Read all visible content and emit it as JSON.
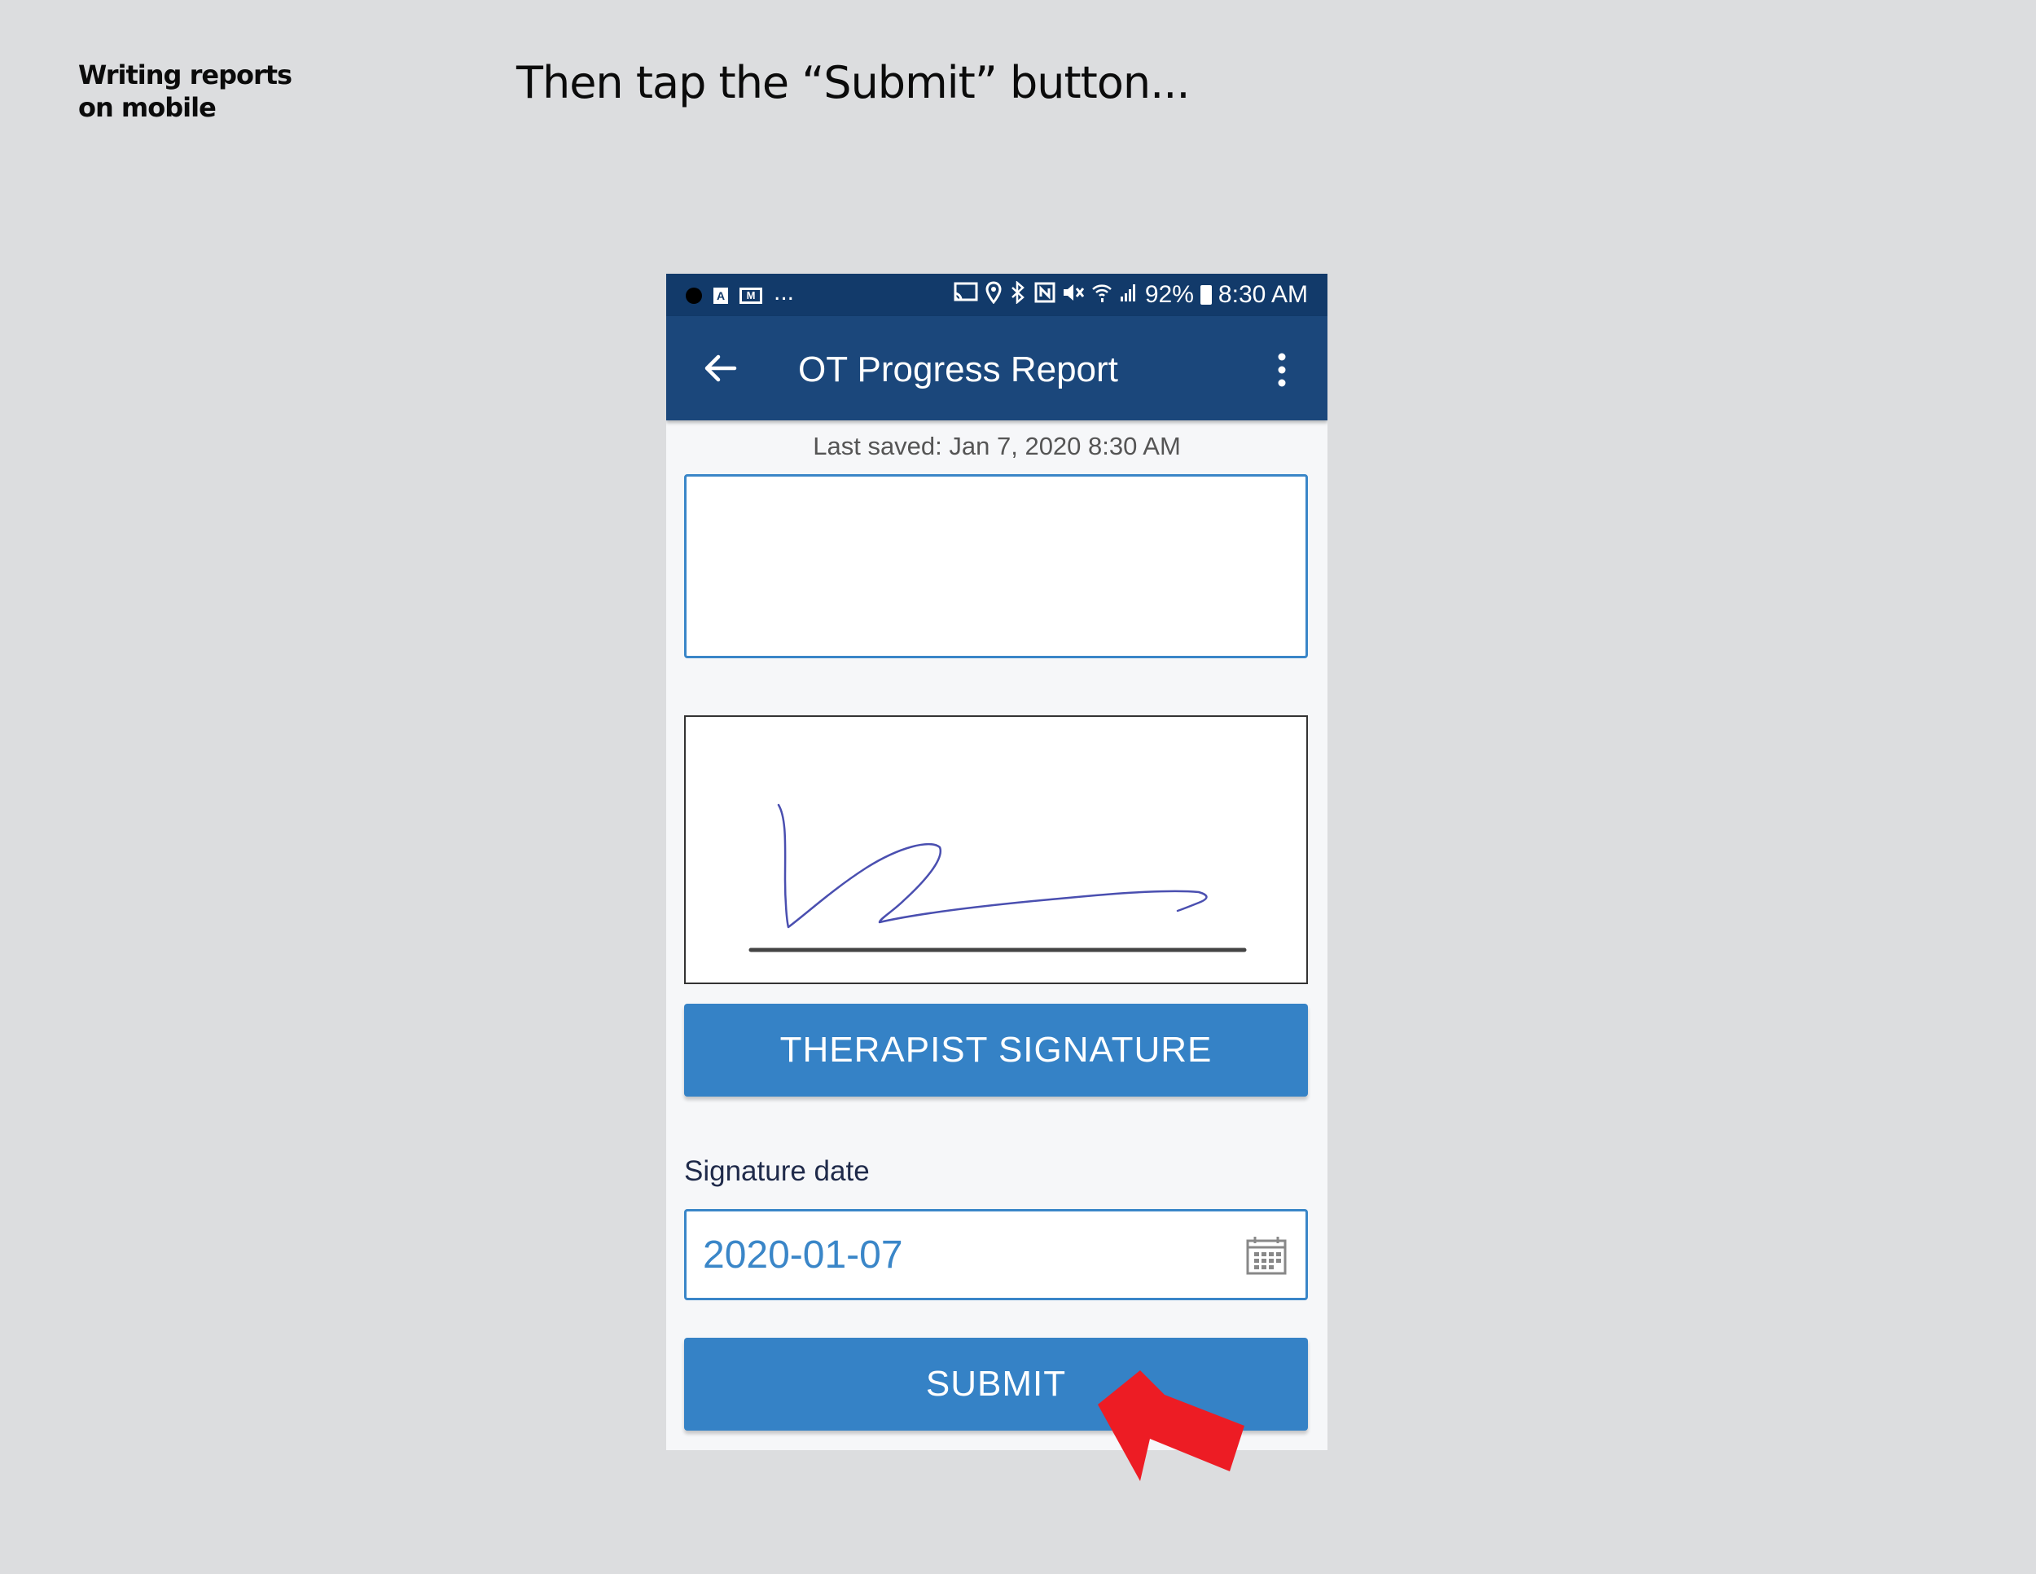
{
  "side_title": {
    "line1": "Writing reports",
    "line2": "on mobile"
  },
  "instruction": "Then tap the “Submit” button...",
  "statusbar": {
    "battery": "92%",
    "time": "8:30 AM",
    "overflow": "...",
    "left_badge": "A",
    "mail_badge": "M"
  },
  "appbar": {
    "title": "OT Progress Report"
  },
  "form": {
    "last_saved": "Last saved: Jan 7, 2020 8:30 AM",
    "text_area_value": "",
    "signature_button": "THERAPIST SIGNATURE",
    "signature_date_label": "Signature date",
    "signature_date_value": "2020-01-07",
    "submit_button": "SUBMIT"
  },
  "icons": [
    "back-arrow-icon",
    "more-vert-icon",
    "calendar-icon",
    "cast-icon",
    "location-icon",
    "bluetooth-icon",
    "nfc-icon",
    "mute-icon",
    "wifi-icon",
    "signal-icon",
    "battery-icon"
  ],
  "colors": {
    "background": "#dcdddf",
    "statusbar": "#123a6a",
    "appbar": "#1b477b",
    "button": "#3582c6",
    "field_border": "#3a86c8",
    "arrow": "#ed1c24",
    "signature_ink": "#4a4fb0"
  }
}
